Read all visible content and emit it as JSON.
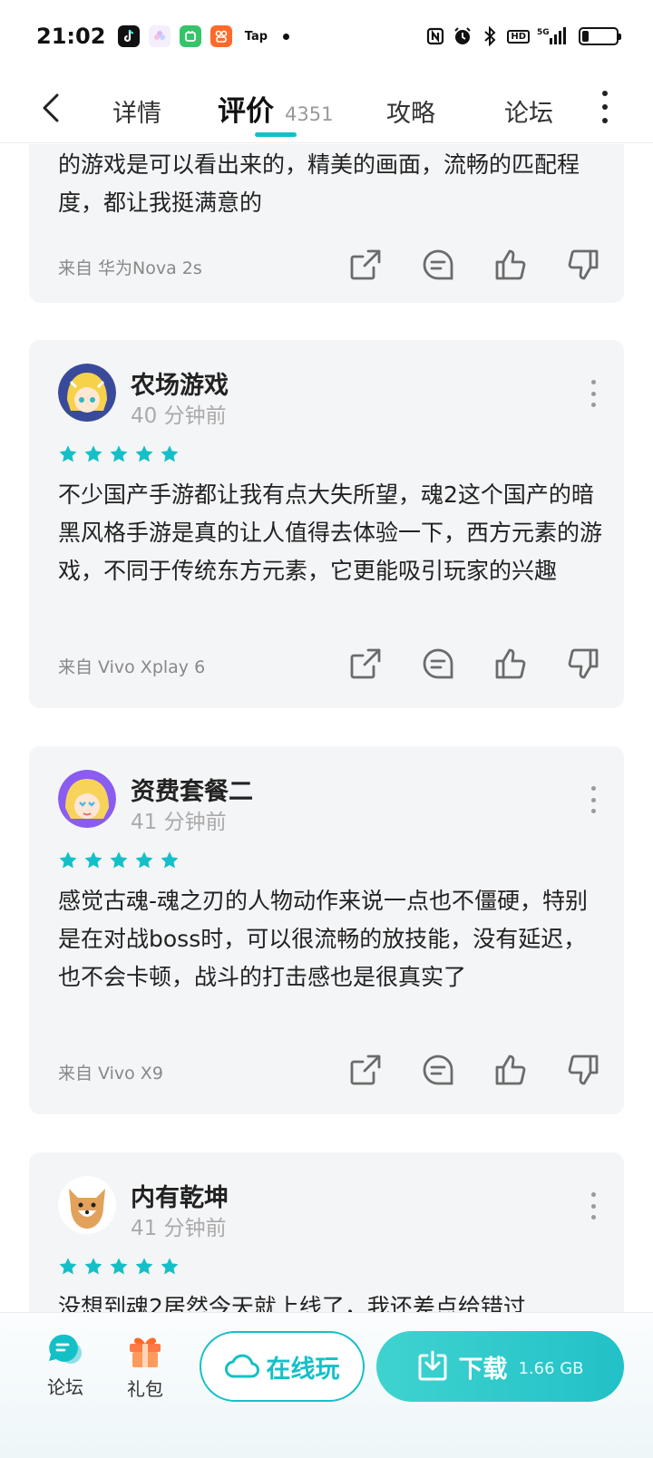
{
  "status_bar": {
    "time": "21:02",
    "app_icons": [
      "tiktok-icon",
      "flower-app-icon",
      "green-app-icon",
      "orange-app-icon",
      "tap-icon"
    ],
    "tap_label": "Tap",
    "network": "5G",
    "battery_level": 0.2
  },
  "nav": {
    "tabs": [
      {
        "label": "详情"
      },
      {
        "label": "评价",
        "count": "4351"
      },
      {
        "label": "攻略"
      },
      {
        "label": "论坛"
      }
    ],
    "active_tab": 1,
    "accent_color": "#14c0c8"
  },
  "reviews": [
    {
      "text": "的游戏是可以看出来的，精美的画面，流畅的匹配程度，都让我挺满意的",
      "device": "来自 华为Nova 2s"
    },
    {
      "user": "农场游戏",
      "time": "40 分钟前",
      "stars": 5,
      "text": "不少国产手游都让我有点大失所望，魂2这个国产的暗黑风格手游是真的让人值得去体验一下，西方元素的游戏，不同于传统东方元素，它更能吸引玩家的兴趣",
      "device": "来自 Vivo Xplay 6"
    },
    {
      "user": "资费套餐二",
      "time": "41 分钟前",
      "stars": 5,
      "text": "感觉古魂-魂之刃的人物动作来说一点也不僵硬，特别是在对战boss时，可以很流畅的放技能，没有延迟，也不会卡顿，战斗的打击感也是很真实了",
      "device": "来自 Vivo X9"
    },
    {
      "user": "内有乾坤",
      "time": "41 分钟前",
      "stars": 5,
      "text": "没想到魂2居然今天就上线了，我还差点给错过"
    }
  ],
  "bottom_bar": {
    "forum_label": "论坛",
    "gift_label": "礼包",
    "online_label": "在线玩",
    "download_label": "下载",
    "download_size": "1.66 GB"
  }
}
